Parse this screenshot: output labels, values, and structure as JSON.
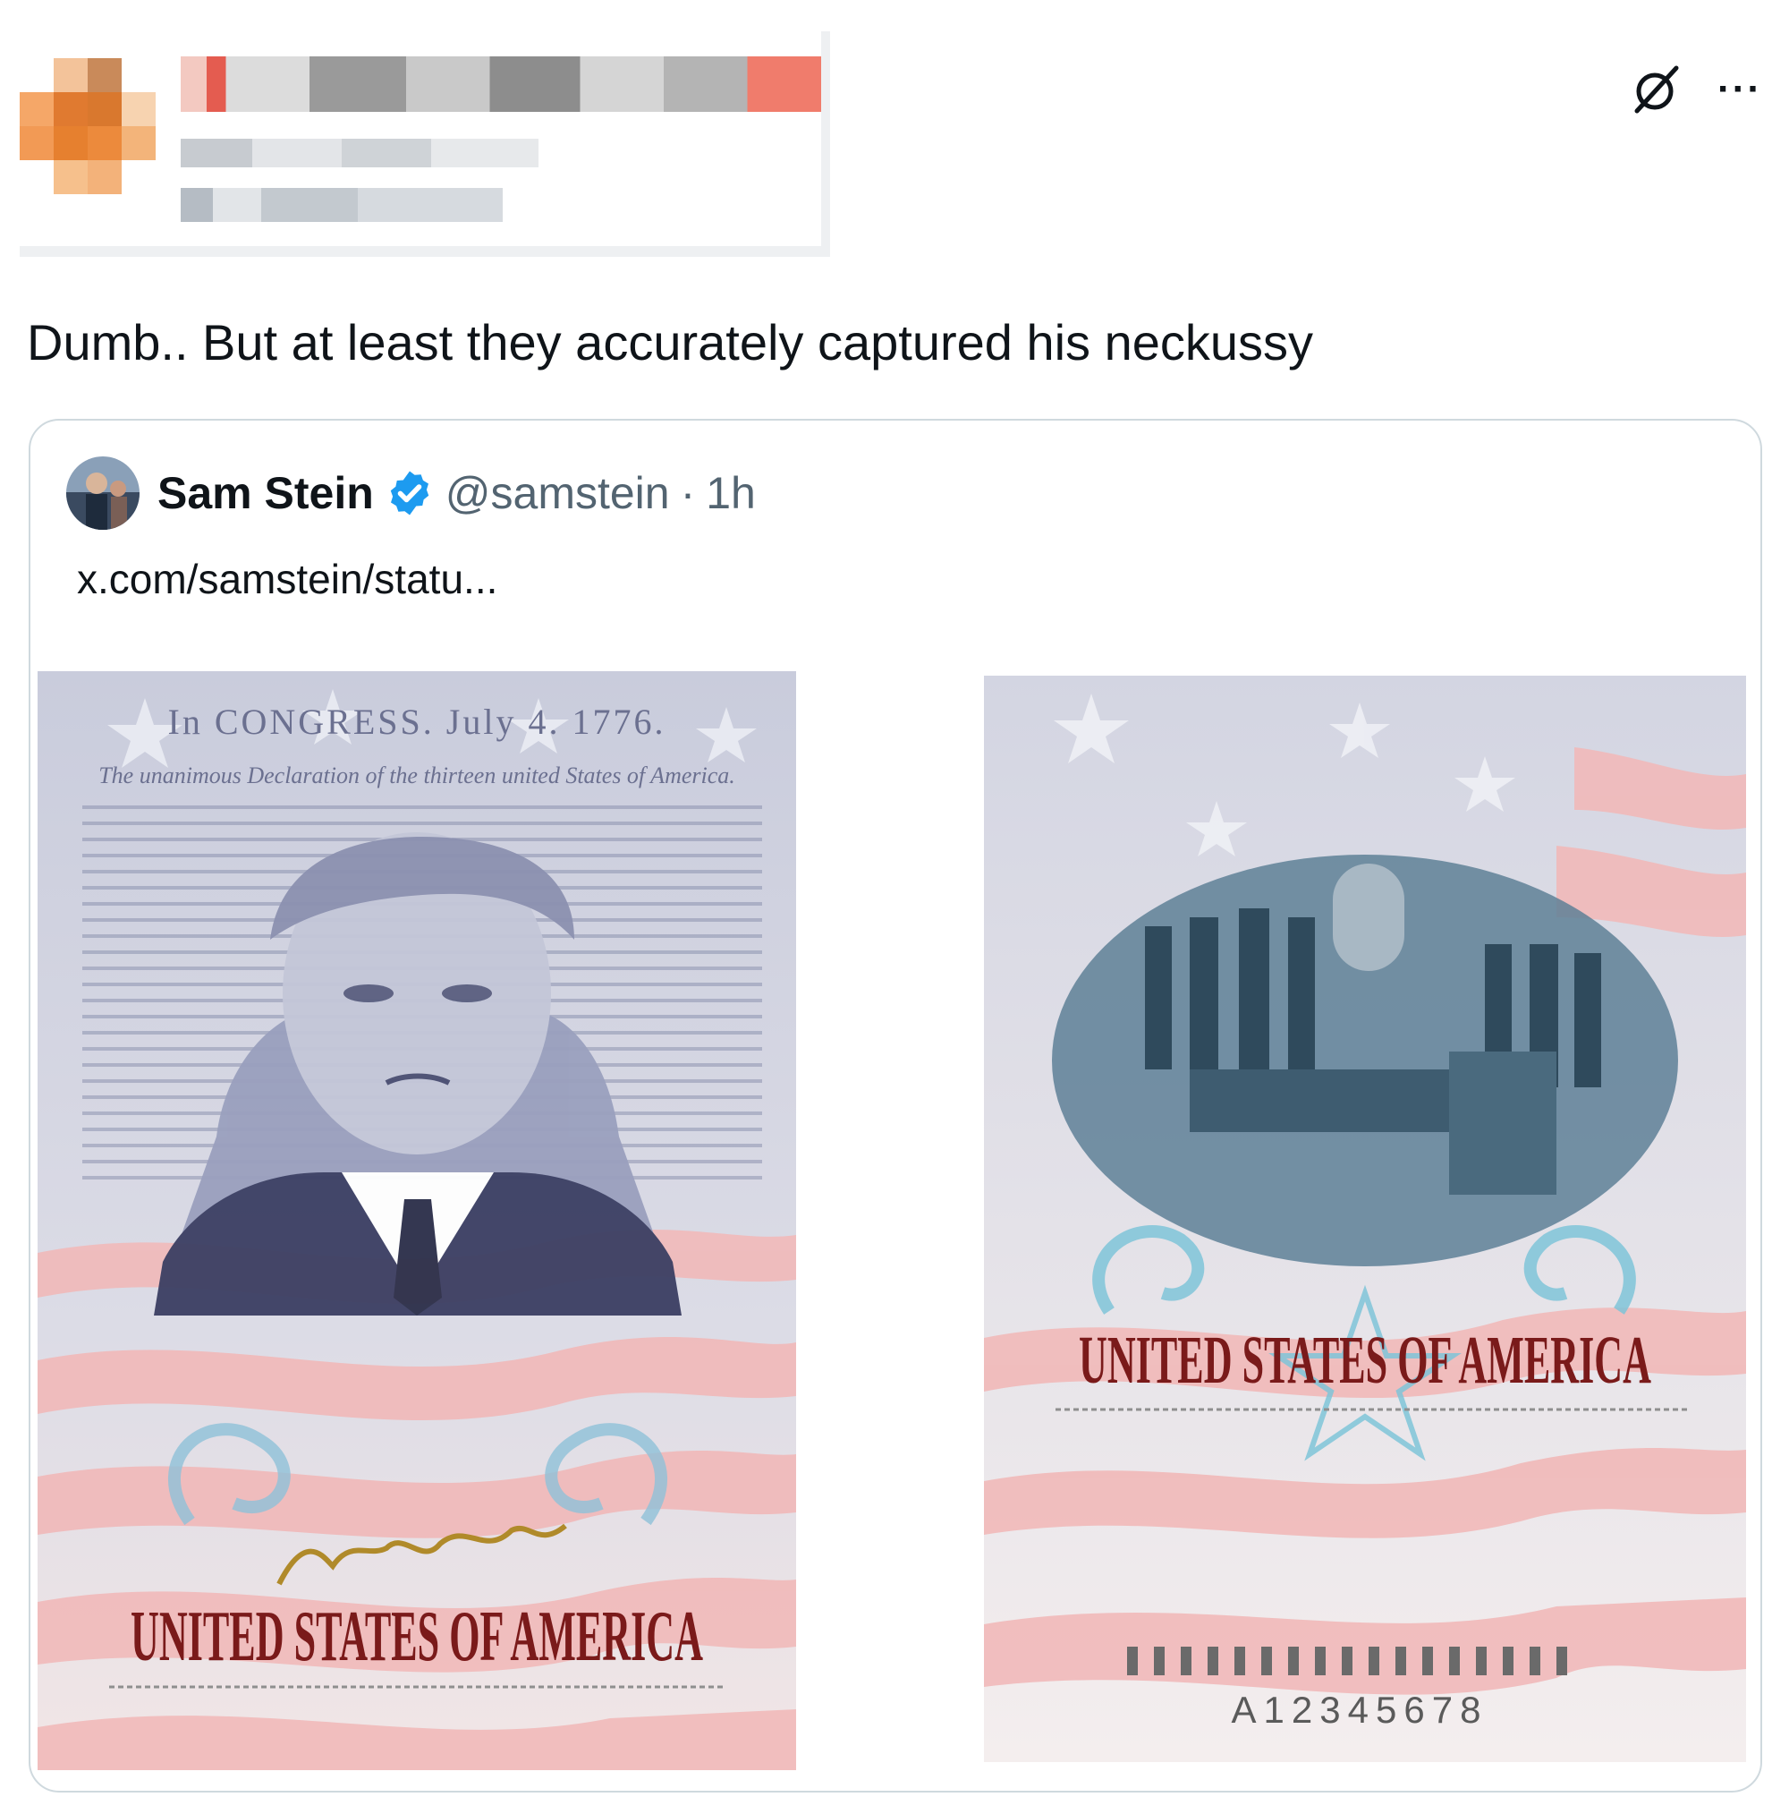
{
  "post": {
    "text": "Dumb.. But at least they accurately captured his neckussy"
  },
  "actions": {
    "grok_icon": "grok-icon",
    "more_label": "···"
  },
  "quote": {
    "name": "Sam Stein",
    "handle": "@samstein",
    "separator": "·",
    "time": "1h",
    "link": "x.com/samstein/statu...",
    "verified_color": "#1d9bf0"
  },
  "media": {
    "left": {
      "heading": "In CONGRESS. July 4. 1776.",
      "subheading": "The unanimous Declaration of the thirteen united States of America.",
      "title": "UNITED STATES OF AMERICA"
    },
    "right": {
      "title": "UNITED STATES OF AMERICA",
      "number": "A12345678"
    }
  },
  "colors": {
    "text": "#0f1419",
    "muted": "#536471",
    "border": "#cfd9de",
    "flag_red": "#f0b4b4",
    "ink_red": "#7a1a1a"
  }
}
